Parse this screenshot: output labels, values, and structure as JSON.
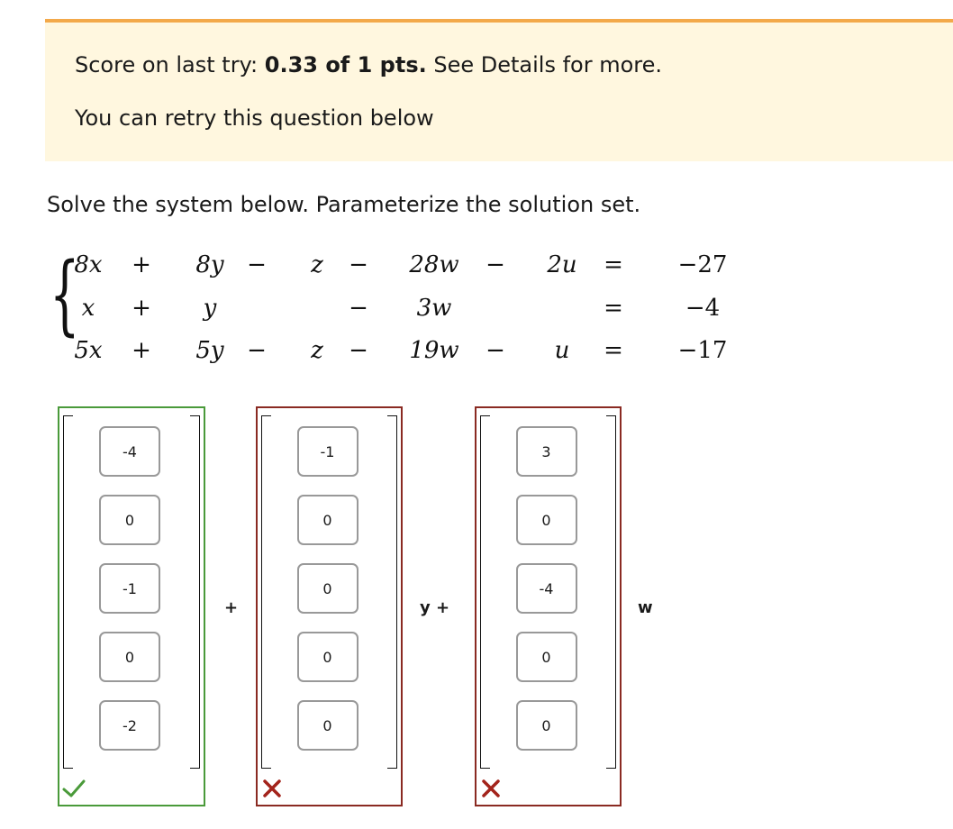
{
  "banner": {
    "score_prefix": "Score on last try: ",
    "score_value": "0.33 of 1 pts.",
    "score_suffix": " See Details for more.",
    "retry": "You can retry this question below"
  },
  "question": {
    "prompt": "Solve the system below. Parameterize the solution set."
  },
  "system": {
    "rows": [
      [
        "8x",
        "+",
        "8y",
        "−",
        "z",
        "−",
        "28w",
        "−",
        "2u",
        "=",
        "−27"
      ],
      [
        "x",
        "+",
        "y",
        "",
        "",
        "−",
        "3w",
        "",
        "",
        "=",
        "−4"
      ],
      [
        "5x",
        "+",
        "5y",
        "−",
        "z",
        "−",
        "19w",
        "−",
        "u",
        "=",
        "−17"
      ]
    ]
  },
  "answer": {
    "vectors": [
      {
        "values": [
          "-4",
          "0",
          "-1",
          "0",
          "-2"
        ],
        "status": "correct",
        "mark": "check-icon"
      },
      {
        "values": [
          "-1",
          "0",
          "0",
          "0",
          "0"
        ],
        "status": "incorrect",
        "mark": "x-icon"
      },
      {
        "values": [
          "3",
          "0",
          "-4",
          "0",
          "0"
        ],
        "status": "incorrect",
        "mark": "x-icon"
      }
    ],
    "plus_1": "+",
    "y_plus": "y +",
    "w": "w"
  },
  "colors": {
    "accent": "#f3a94a",
    "banner_bg": "#fff7df",
    "correct": "#4a9a3a",
    "incorrect": "#8a2a22"
  }
}
